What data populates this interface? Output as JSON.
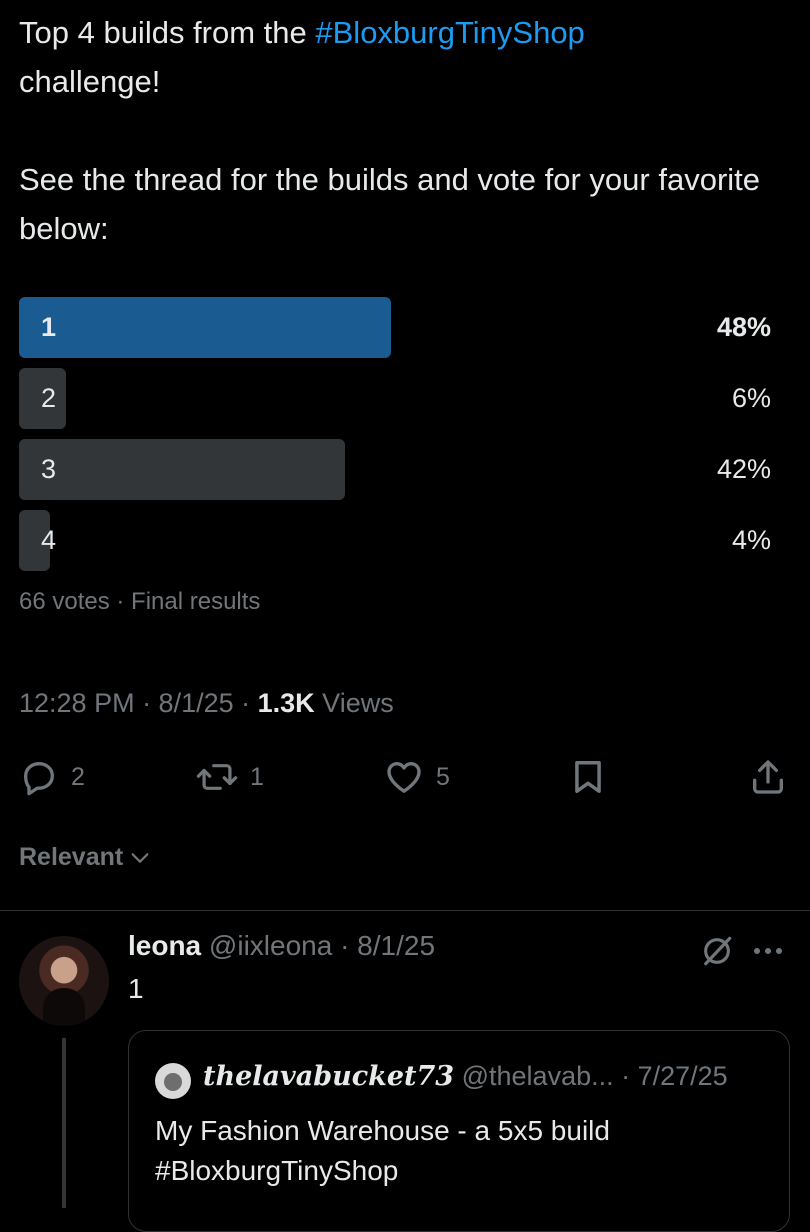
{
  "tweet": {
    "line1_prefix": "Top 4 builds from the ",
    "hashtag": "#BloxburgTinyShop",
    "line1_suffix": "challenge!",
    "line2": "See the thread for the builds and vote for your favorite below:"
  },
  "poll": {
    "options": [
      {
        "label": "1",
        "percent_text": "48%",
        "fraction": 0.48,
        "winner": true
      },
      {
        "label": "2",
        "percent_text": "6%",
        "fraction": 0.06,
        "winner": false
      },
      {
        "label": "3",
        "percent_text": "42%",
        "fraction": 0.42,
        "winner": false
      },
      {
        "label": "4",
        "percent_text": "4%",
        "fraction": 0.04,
        "winner": false
      }
    ],
    "meta": "66 votes · Final results"
  },
  "timestamp": {
    "time_date": "12:28 PM · 8/1/25 · ",
    "views_count": "1.3K",
    "views_label": " Views"
  },
  "actions": {
    "reply_count": "2",
    "retweet_count": "1",
    "like_count": "5"
  },
  "sort": {
    "label": "Relevant"
  },
  "reply": {
    "name": "leona",
    "handle_date": " @iixleona · 8/1/25",
    "text": "1"
  },
  "quote": {
    "name": "thelavabucket73",
    "handle_date": " @thelavab... · 7/27/25",
    "text": "My Fashion Warehouse - a 5x5 build #BloxburgTinyShop"
  },
  "colors": {
    "winner_bar": "#1a5b92",
    "bar": "#333639",
    "link": "#1d9bf0",
    "muted": "#71767b"
  },
  "icons": [
    "reply-icon",
    "retweet-icon",
    "like-icon",
    "bookmark-icon",
    "share-icon",
    "chevron-down-icon",
    "grok-icon",
    "more-icon"
  ]
}
